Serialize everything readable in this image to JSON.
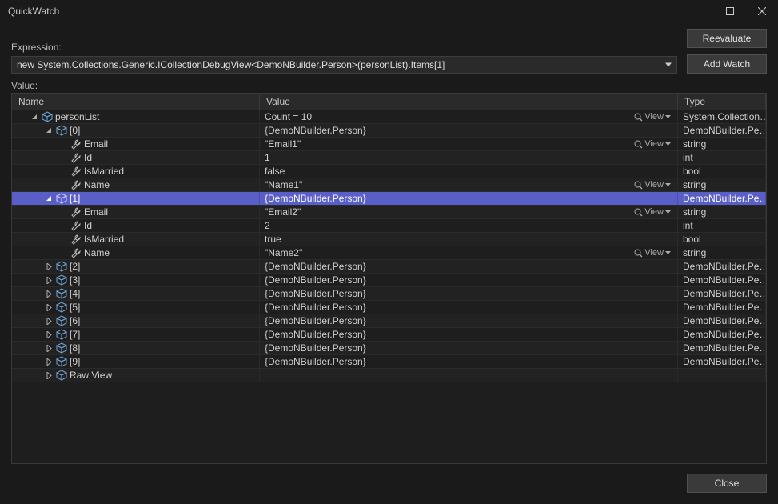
{
  "window": {
    "title": "QuickWatch"
  },
  "labels": {
    "expression": "Expression:",
    "value": "Value:",
    "reevaluate": "Reevaluate",
    "addWatch": "Add Watch",
    "close": "Close",
    "view": "View"
  },
  "expression": "new System.Collections.Generic.ICollectionDebugView<DemoNBuilder.Person>(personList).Items[1]",
  "columns": {
    "name": "Name",
    "value": "Value",
    "type": "Type"
  },
  "rows": [
    {
      "indent": 0,
      "exp": "open",
      "icon": "box",
      "name": "personList",
      "value": "Count = 10",
      "view": true,
      "type": "System.Collection…",
      "sel": false
    },
    {
      "indent": 1,
      "exp": "open",
      "icon": "box",
      "name": "[0]",
      "value": "{DemoNBuilder.Person}",
      "view": false,
      "type": "DemoNBuilder.Pe…",
      "sel": false
    },
    {
      "indent": 2,
      "exp": "none",
      "icon": "wrench",
      "name": "Email",
      "value": "\"Email1\"",
      "view": true,
      "type": "string",
      "sel": false
    },
    {
      "indent": 2,
      "exp": "none",
      "icon": "wrench",
      "name": "Id",
      "value": "1",
      "view": false,
      "type": "int",
      "sel": false
    },
    {
      "indent": 2,
      "exp": "none",
      "icon": "wrench",
      "name": "IsMarried",
      "value": "false",
      "view": false,
      "type": "bool",
      "sel": false
    },
    {
      "indent": 2,
      "exp": "none",
      "icon": "wrench",
      "name": "Name",
      "value": "\"Name1\"",
      "view": true,
      "type": "string",
      "sel": false
    },
    {
      "indent": 1,
      "exp": "open",
      "icon": "box",
      "name": "[1]",
      "value": "{DemoNBuilder.Person}",
      "view": false,
      "type": "DemoNBuilder.Pe…",
      "sel": true
    },
    {
      "indent": 2,
      "exp": "none",
      "icon": "wrench",
      "name": "Email",
      "value": "\"Email2\"",
      "view": true,
      "type": "string",
      "sel": false
    },
    {
      "indent": 2,
      "exp": "none",
      "icon": "wrench",
      "name": "Id",
      "value": "2",
      "view": false,
      "type": "int",
      "sel": false
    },
    {
      "indent": 2,
      "exp": "none",
      "icon": "wrench",
      "name": "IsMarried",
      "value": "true",
      "view": false,
      "type": "bool",
      "sel": false
    },
    {
      "indent": 2,
      "exp": "none",
      "icon": "wrench",
      "name": "Name",
      "value": "\"Name2\"",
      "view": true,
      "type": "string",
      "sel": false
    },
    {
      "indent": 1,
      "exp": "closed",
      "icon": "box",
      "name": "[2]",
      "value": "{DemoNBuilder.Person}",
      "view": false,
      "type": "DemoNBuilder.Pe…",
      "sel": false
    },
    {
      "indent": 1,
      "exp": "closed",
      "icon": "box",
      "name": "[3]",
      "value": "{DemoNBuilder.Person}",
      "view": false,
      "type": "DemoNBuilder.Pe…",
      "sel": false
    },
    {
      "indent": 1,
      "exp": "closed",
      "icon": "box",
      "name": "[4]",
      "value": "{DemoNBuilder.Person}",
      "view": false,
      "type": "DemoNBuilder.Pe…",
      "sel": false
    },
    {
      "indent": 1,
      "exp": "closed",
      "icon": "box",
      "name": "[5]",
      "value": "{DemoNBuilder.Person}",
      "view": false,
      "type": "DemoNBuilder.Pe…",
      "sel": false
    },
    {
      "indent": 1,
      "exp": "closed",
      "icon": "box",
      "name": "[6]",
      "value": "{DemoNBuilder.Person}",
      "view": false,
      "type": "DemoNBuilder.Pe…",
      "sel": false
    },
    {
      "indent": 1,
      "exp": "closed",
      "icon": "box",
      "name": "[7]",
      "value": "{DemoNBuilder.Person}",
      "view": false,
      "type": "DemoNBuilder.Pe…",
      "sel": false
    },
    {
      "indent": 1,
      "exp": "closed",
      "icon": "box",
      "name": "[8]",
      "value": "{DemoNBuilder.Person}",
      "view": false,
      "type": "DemoNBuilder.Pe…",
      "sel": false
    },
    {
      "indent": 1,
      "exp": "closed",
      "icon": "box",
      "name": "[9]",
      "value": "{DemoNBuilder.Person}",
      "view": false,
      "type": "DemoNBuilder.Pe…",
      "sel": false
    },
    {
      "indent": 1,
      "exp": "closed",
      "icon": "box",
      "name": "Raw View",
      "value": "",
      "view": false,
      "type": "",
      "sel": false
    }
  ]
}
